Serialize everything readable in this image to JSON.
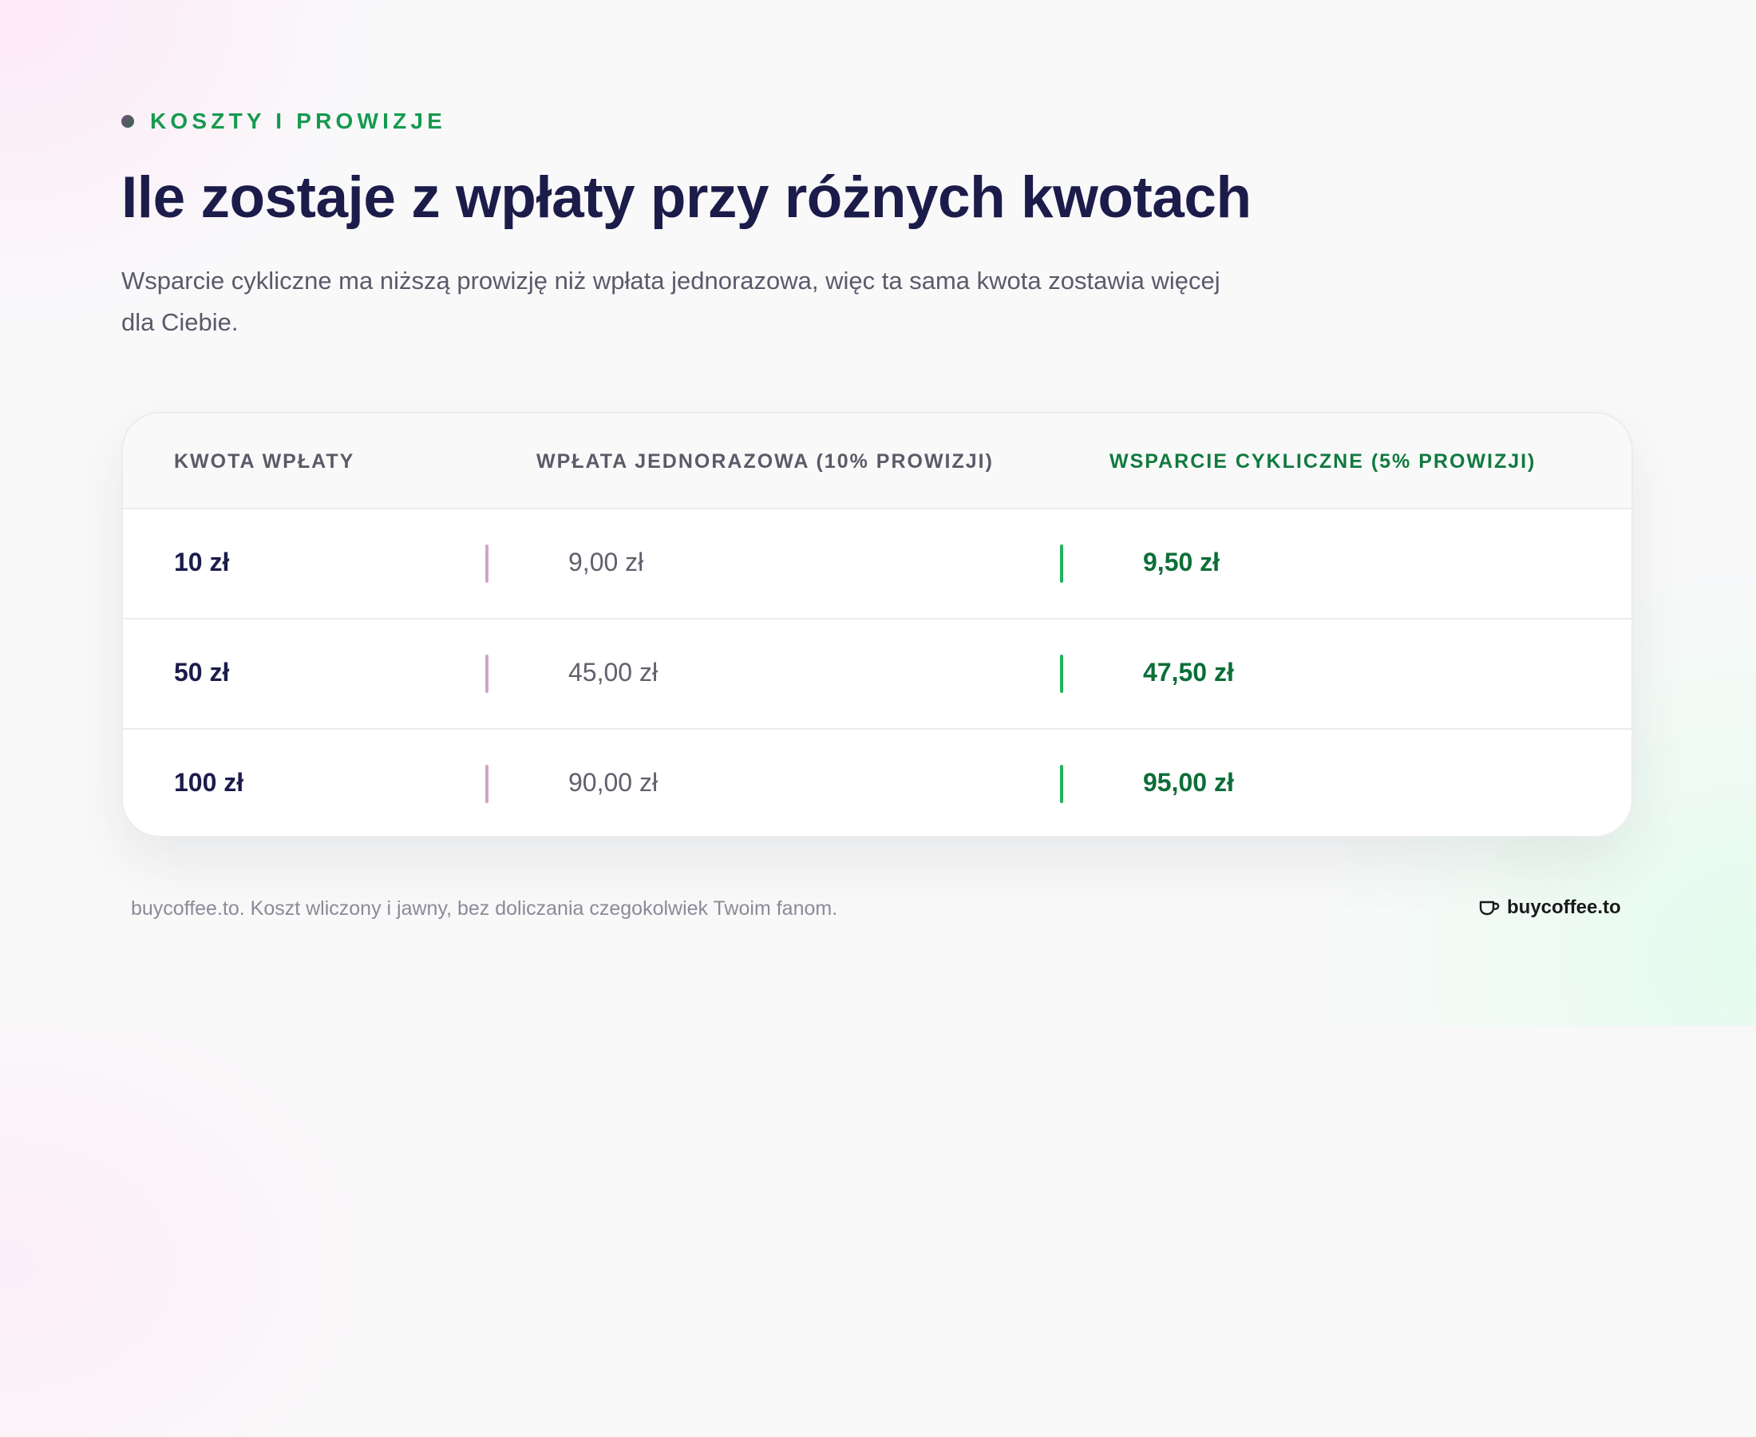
{
  "section": {
    "eyebrow": "KOSZTY I PROWIZJE",
    "title": "Ile zostaje z wpłaty przy różnych kwotach",
    "subtitle": "Wsparcie cykliczne ma niższą prowizję niż wpłata jednorazowa, więc ta sama kwota zostawia więcej dla Ciebie."
  },
  "table": {
    "headers": {
      "amount": "KWOTA WPŁATY",
      "one_time": "WPŁATA JEDNORAZOWA (10% PROWIZJI)",
      "recurring": "WSPARCIE CYKLICZNE (5% PROWIZJI)"
    },
    "rows": [
      {
        "amount": "10 zł",
        "one_time": "9,00 zł",
        "recurring": "9,50 zł"
      },
      {
        "amount": "50 zł",
        "one_time": "45,00 zł",
        "recurring": "47,50 zł"
      },
      {
        "amount": "100 zł",
        "one_time": "90,00 zł",
        "recurring": "95,00 zł"
      }
    ]
  },
  "footer": {
    "note": "buycoffee.to. Koszt wliczony i jawny, bez doliczania czegokolwiek Twoim fanom.",
    "brand": "buycoffee.to",
    "brand_icon": "coffee-cup-icon"
  },
  "colors": {
    "accent_green": "#169a4f",
    "recurring_green": "#0c6e37",
    "title_navy": "#1c1c4b",
    "one_time_bar": "#d1a4c9",
    "recurring_bar": "#22b35e"
  }
}
